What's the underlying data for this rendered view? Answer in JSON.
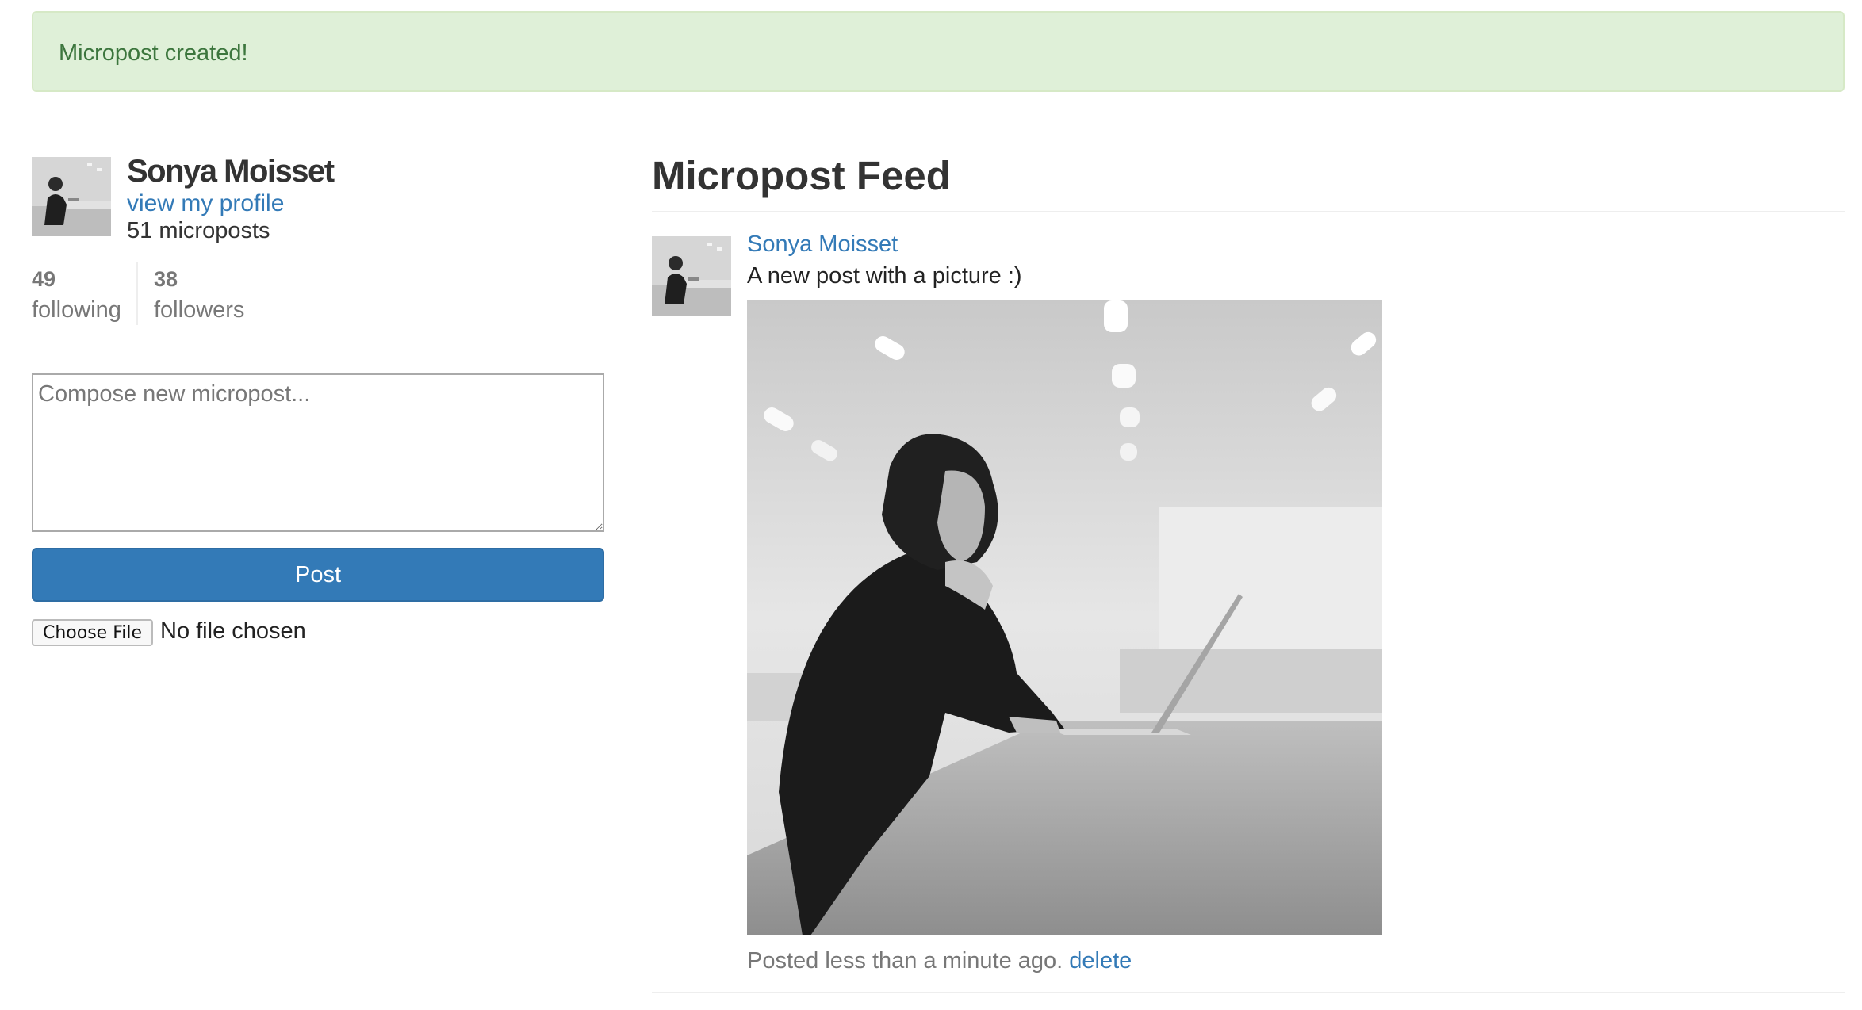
{
  "flash": {
    "message": "Micropost created!",
    "color": "#3c763d",
    "background": "#dff0d8"
  },
  "user": {
    "name": "Sonya Moisset",
    "profile_link": "view my profile",
    "micropost_count": "51 microposts",
    "avatar_icon": "user-photo"
  },
  "stats": {
    "following_count": "49",
    "following_label": "following",
    "followers_count": "38",
    "followers_label": "followers"
  },
  "compose": {
    "placeholder": "Compose new micropost...",
    "value": "",
    "post_label": "Post",
    "choose_file_label": "Choose File",
    "no_file_text": "No file chosen"
  },
  "feed": {
    "title": "Micropost Feed",
    "items": [
      {
        "author": "Sonya Moisset",
        "content": "A new post with a picture :)",
        "timestamp": "Posted less than a minute ago.",
        "delete_label": "delete",
        "image": "photo-woman-with-laptop"
      }
    ]
  },
  "colors": {
    "link": "#337ab7",
    "muted": "#777777",
    "primary_button": "#337ab7"
  }
}
